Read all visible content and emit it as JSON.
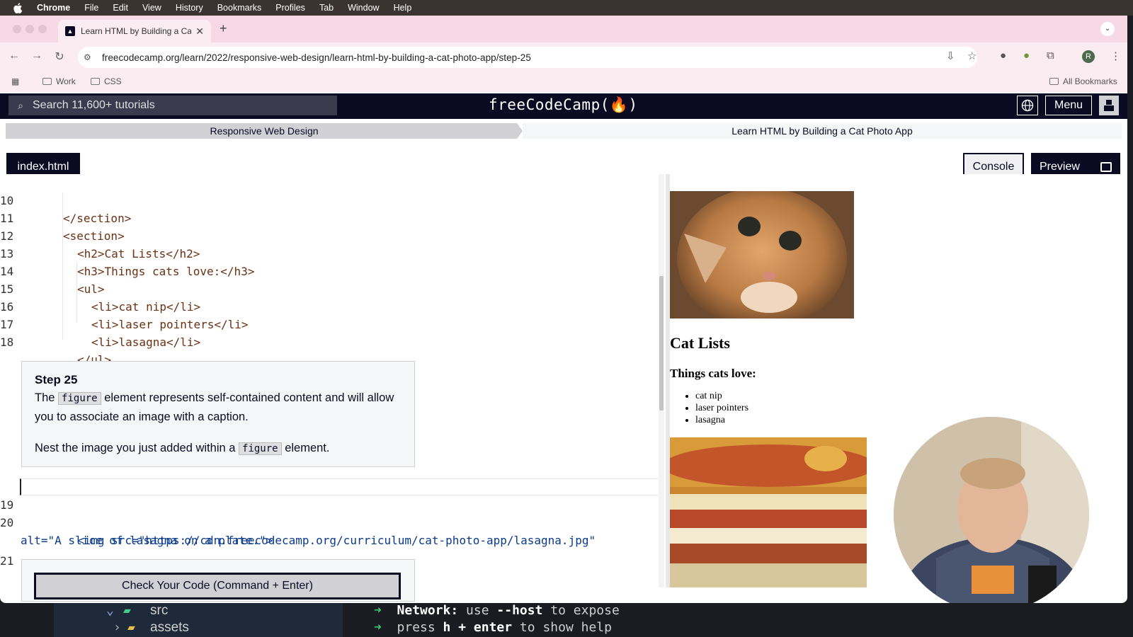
{
  "menubar": {
    "app": "Chrome",
    "items": [
      "File",
      "Edit",
      "View",
      "History",
      "Bookmarks",
      "Profiles",
      "Tab",
      "Window",
      "Help"
    ]
  },
  "browser": {
    "tab_title": "Learn HTML by Building a Cat",
    "url": "freecodecamp.org/learn/2022/responsive-web-design/learn-html-by-building-a-cat-photo-app/step-25",
    "bookmarks": [
      "Work",
      "CSS"
    ],
    "all_bookmarks": "All Bookmarks",
    "profile_initial": "R"
  },
  "fcc": {
    "search_placeholder": "Search 11,600+ tutorials",
    "logo": "freeCodeCamp(🔥)",
    "menu_label": "Menu",
    "breadcrumb_course": "Responsive Web Design",
    "breadcrumb_project": "Learn HTML by Building a Cat Photo App",
    "file_tab": "index.html",
    "console_label": "Console",
    "preview_label": "Preview",
    "check_button": "Check Your Code (Command + Enter)"
  },
  "code_lines": [
    {
      "n": "10",
      "text": "</section>"
    },
    {
      "n": "11",
      "text": "<section>"
    },
    {
      "n": "12",
      "text": "<h2>Cat Lists</h2>"
    },
    {
      "n": "13",
      "text": "<h3>Things cats love:</h3>"
    },
    {
      "n": "14",
      "text": "<ul>"
    },
    {
      "n": "15",
      "text": "<li>cat nip</li>"
    },
    {
      "n": "16",
      "text": "<li>laser pointers</li>"
    },
    {
      "n": "17",
      "text": "<li>lasagna</li>"
    },
    {
      "n": "18",
      "text": "</ul>"
    },
    {
      "n": "19",
      "text": ""
    },
    {
      "n": "20",
      "text": "<img src=\"https://cdn.freecodecamp.org/curriculum/cat-photo-app/lasagna.jpg\""
    },
    {
      "n": "",
      "text": "alt=\"A slice of lasagna on a plate.\">"
    },
    {
      "n": "21",
      "text": ""
    }
  ],
  "step": {
    "title": "Step 25",
    "p1_before": "The",
    "p1_code": "figure",
    "p1_after": "element represents self-contained content and will allow you to associate an image with a caption.",
    "p2_before": "Nest the image you just added within a",
    "p2_code": "figure",
    "p2_after": "element."
  },
  "preview": {
    "h2": "Cat Lists",
    "h3": "Things cats love:",
    "items": [
      "cat nip",
      "laser pointers",
      "lasagna"
    ]
  },
  "terminal": {
    "line1_label": "Network:",
    "line1_text": " use ",
    "line1_flag": "--host",
    "line1_end": " to expose",
    "line2_text": "press ",
    "line2_key": "h + enter",
    "line2_end": " to show help",
    "tree_src": "src",
    "tree_assets": "assets"
  },
  "colors": {
    "fcc_dark": "#0a0a23",
    "tab_strip": "#f6d9e4",
    "toolbar": "#fbecf1"
  }
}
